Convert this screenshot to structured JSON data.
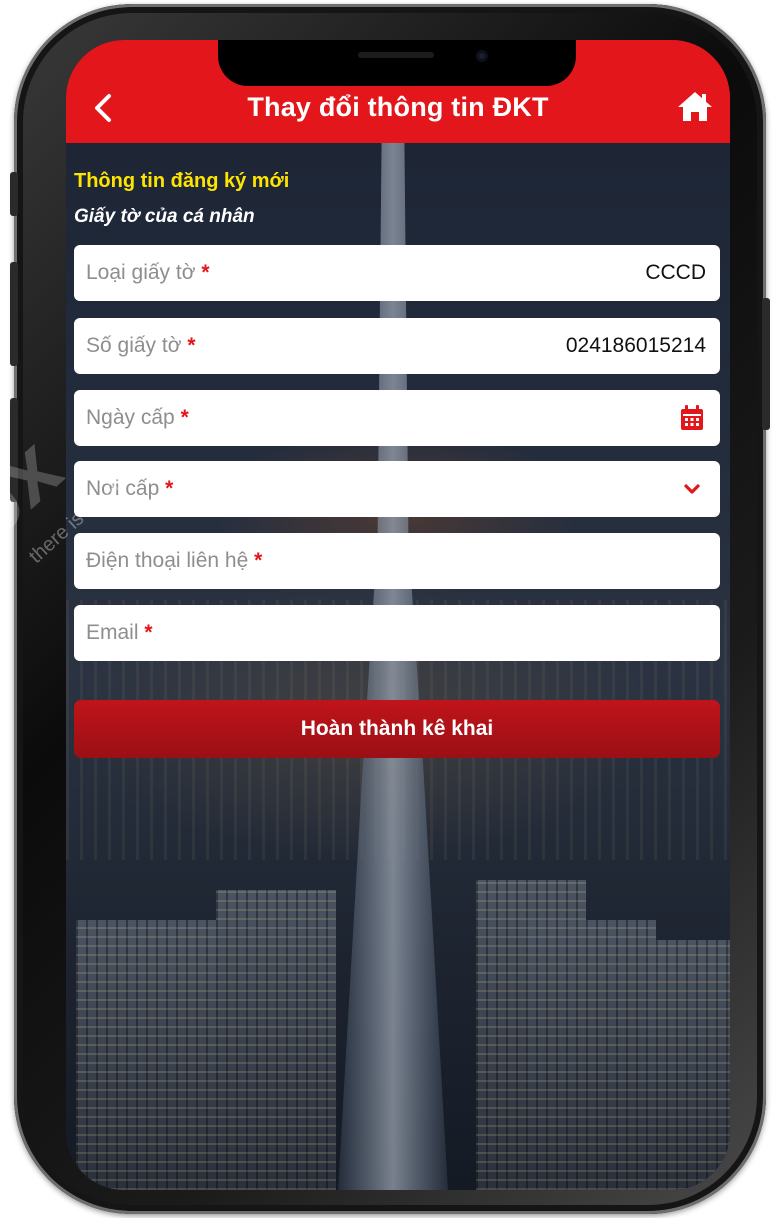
{
  "header": {
    "title": "Thay đổi thông tin ĐKT",
    "back_icon": "chevron-left-icon",
    "home_icon": "home-icon"
  },
  "form": {
    "section_title": "Thông tin đăng ký mới",
    "section_subtitle": "Giấy tờ của cá nhân",
    "required_mark": "*",
    "fields": [
      {
        "label": "Loại giấy tờ",
        "value": "CCCD"
      },
      {
        "label": "Số giấy tờ",
        "value": "024186015214"
      },
      {
        "label": "Ngày cấp",
        "value": "",
        "icon": "calendar-icon"
      },
      {
        "label": "Nơi cấp",
        "value": "",
        "icon": "chevron-down-icon"
      },
      {
        "label": "Điện thoại liên hệ",
        "value": ""
      },
      {
        "label": "Email",
        "value": ""
      }
    ],
    "submit_label": "Hoàn thành kê khai"
  },
  "watermark": {
    "text": "there is a way"
  },
  "colors": {
    "header_red": "#e3161b",
    "button_red": "#b01218",
    "section_title_yellow": "#ffe400",
    "required_red": "#e3161b"
  }
}
